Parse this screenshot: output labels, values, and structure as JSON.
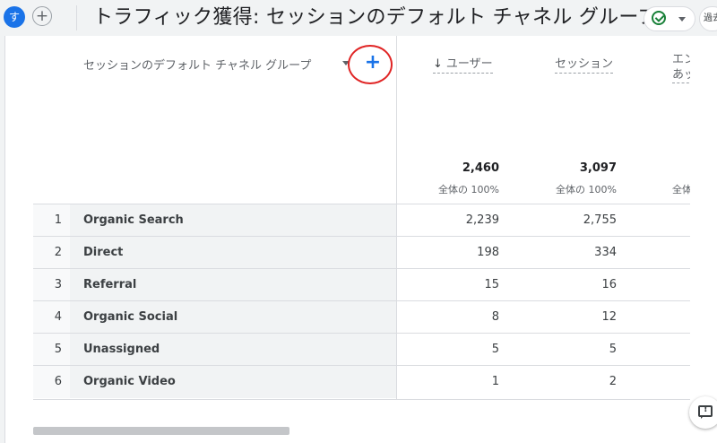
{
  "header": {
    "avatar_letter": "す",
    "add_label": "+",
    "title": "トラフィック獲得: セッションのデフォルト チャネル グループ",
    "past_label": "過去"
  },
  "table": {
    "dimension_header": "セッションのデフォルト チャネル グループ",
    "add_dimension_label": "+",
    "columns": [
      {
        "label": "ユーザー",
        "sorted": "descending",
        "total": "2,460",
        "total_sub": "全体の 100%"
      },
      {
        "label": "セッション",
        "total": "3,097",
        "total_sub": "全体の 100%"
      },
      {
        "label": "エンのあッシ",
        "total_sub": "全体"
      }
    ],
    "rows": [
      {
        "index": "1",
        "channel": "Organic Search",
        "users": "2,239",
        "sessions": "2,755"
      },
      {
        "index": "2",
        "channel": "Direct",
        "users": "198",
        "sessions": "334"
      },
      {
        "index": "3",
        "channel": "Referral",
        "users": "15",
        "sessions": "16"
      },
      {
        "index": "4",
        "channel": "Organic Social",
        "users": "8",
        "sessions": "12"
      },
      {
        "index": "5",
        "channel": "Unassigned",
        "users": "5",
        "sessions": "5"
      },
      {
        "index": "6",
        "channel": "Organic Video",
        "users": "1",
        "sessions": "2"
      }
    ]
  },
  "icons": {
    "status": "check-circle-icon",
    "sort": "arrow-down-icon",
    "feedback": "feedback-icon"
  },
  "colors": {
    "accent": "#1a73e8",
    "status_green": "#188038",
    "highlight_ring": "#e02424"
  }
}
